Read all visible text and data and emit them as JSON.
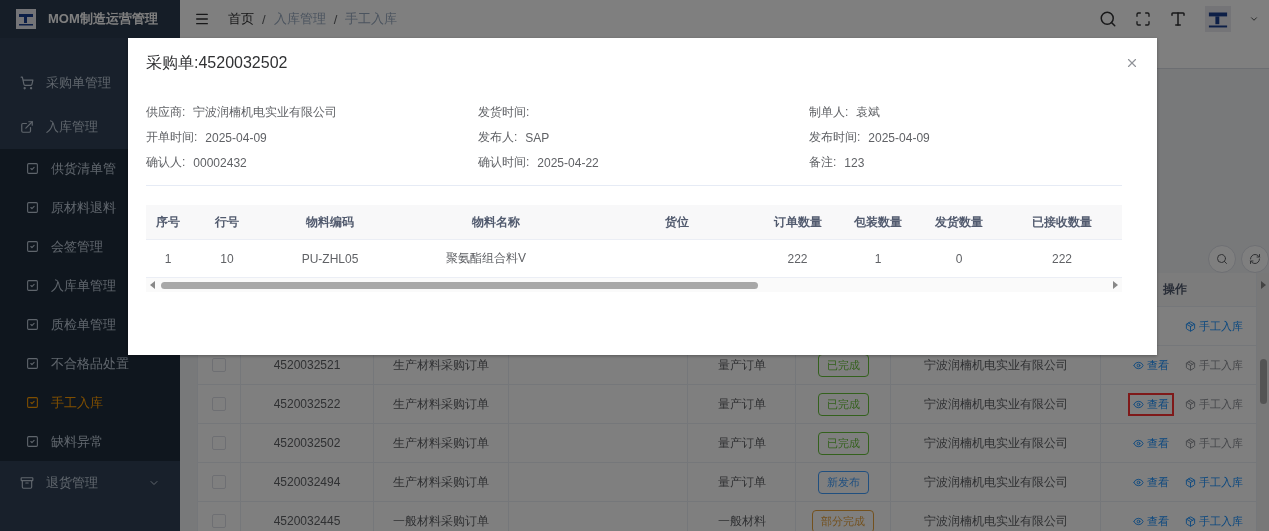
{
  "sidebar": {
    "title": "MOM制造运营管理",
    "items": [
      {
        "label": "采购单管理"
      },
      {
        "label": "入库管理",
        "expanded": true,
        "children": [
          {
            "label": "供货清单管",
            "selected": false
          },
          {
            "label": "原材料退料",
            "selected": false
          },
          {
            "label": "会签管理",
            "selected": false
          },
          {
            "label": "入库单管理",
            "selected": false
          },
          {
            "label": "质检单管理",
            "selected": false
          },
          {
            "label": "不合格品处置",
            "selected": false
          },
          {
            "label": "手工入库",
            "selected": true
          },
          {
            "label": "缺料异常",
            "selected": false
          }
        ]
      },
      {
        "label": "退货管理",
        "expanded": false
      }
    ]
  },
  "header": {
    "breadcrumbs": [
      {
        "label": "首页"
      },
      {
        "separator": "/",
        "label": "入库管理"
      },
      {
        "separator": "/",
        "label": "手工入库"
      }
    ]
  },
  "table": {
    "columns": [
      {
        "label": "操作"
      }
    ],
    "rows": [
      {
        "actions": [
          {
            "kind": "stock_in",
            "label": "手工入库",
            "disabled": false
          }
        ]
      },
      {
        "checked": false,
        "order_no": "4520032521",
        "type": "生产材料采购订单",
        "category": "量产订单",
        "status": {
          "label": "已完成",
          "kind": "done"
        },
        "supplier": "宁波润楠机电实业有限公司",
        "actions": [
          {
            "kind": "view",
            "label": "查看",
            "highlighted": false
          },
          {
            "kind": "stock_in",
            "label": "手工入库",
            "disabled": true
          }
        ]
      },
      {
        "checked": false,
        "order_no": "4520032522",
        "type": "生产材料采购订单",
        "category": "量产订单",
        "status": {
          "label": "已完成",
          "kind": "done"
        },
        "supplier": "宁波润楠机电实业有限公司",
        "actions": [
          {
            "kind": "view",
            "label": "查看",
            "highlighted": true
          },
          {
            "kind": "stock_in",
            "label": "手工入库",
            "disabled": true
          }
        ]
      },
      {
        "checked": false,
        "order_no": "4520032502",
        "type": "生产材料采购订单",
        "category": "量产订单",
        "status": {
          "label": "已完成",
          "kind": "done"
        },
        "supplier": "宁波润楠机电实业有限公司",
        "actions": [
          {
            "kind": "view",
            "label": "查看",
            "highlighted": false
          },
          {
            "kind": "stock_in",
            "label": "手工入库",
            "disabled": true
          }
        ]
      },
      {
        "checked": false,
        "order_no": "4520032494",
        "type": "生产材料采购订单",
        "category": "量产订单",
        "status": {
          "label": "新发布",
          "kind": "new"
        },
        "supplier": "宁波润楠机电实业有限公司",
        "actions": [
          {
            "kind": "view",
            "label": "查看",
            "highlighted": false
          },
          {
            "kind": "stock_in",
            "label": "手工入库",
            "disabled": false
          }
        ]
      },
      {
        "checked": false,
        "order_no": "4520032445",
        "type": "一般材料采购订单",
        "category": "一般材料",
        "status": {
          "label": "部分完成",
          "kind": "partial"
        },
        "supplier": "宁波润楠机电实业有限公司",
        "actions": [
          {
            "kind": "view",
            "label": "查看",
            "highlighted": false
          },
          {
            "kind": "stock_in",
            "label": "手工入库",
            "disabled": false
          }
        ]
      }
    ]
  },
  "dialog": {
    "title": "采购单:4520032502",
    "fields": [
      {
        "label": "供应商:",
        "value": "宁波润楠机电实业有限公司"
      },
      {
        "label": "发货时间:"
      },
      {
        "label": "制单人:",
        "value": "袁斌"
      },
      {
        "label": "开单时间:",
        "value": "2025-04-09"
      },
      {
        "label": "发布人:",
        "value": "SAP"
      },
      {
        "label": "发布时间:",
        "value": "2025-04-09"
      },
      {
        "label": "确认人:",
        "value": "00002432"
      },
      {
        "label": "确认时间:",
        "value": "2025-04-22"
      },
      {
        "label": "备注:",
        "value": "123"
      }
    ],
    "table": {
      "columns": [
        "序号",
        "行号",
        "物料编码",
        "物料名称",
        "货位",
        "订单数量",
        "包装数量",
        "发货数量",
        "已接收数量"
      ],
      "rows": [
        [
          "1",
          "10",
          "PU-ZHL05",
          "聚氨酯组合料V",
          "",
          "222",
          "1",
          "0",
          "222"
        ]
      ]
    }
  }
}
